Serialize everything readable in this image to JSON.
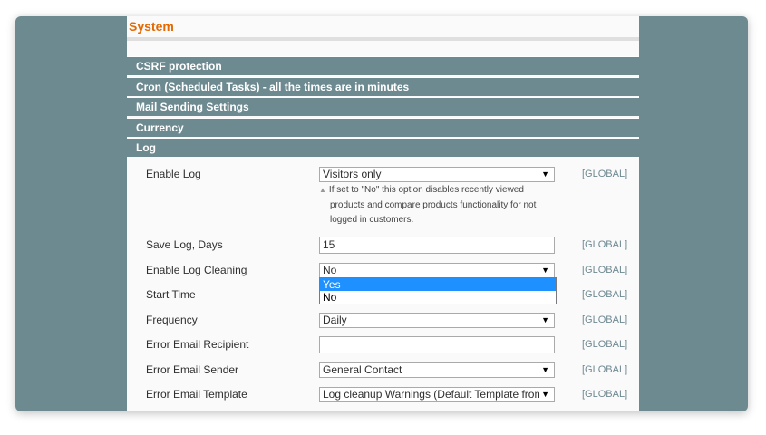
{
  "page": {
    "title": "System"
  },
  "sections": [
    "CSRF protection",
    "Cron (Scheduled Tasks) - all the times are in minutes",
    "Mail Sending Settings",
    "Currency",
    "Log"
  ],
  "log": {
    "enable_log": {
      "label": "Enable Log",
      "value": "Visitors only",
      "scope": "[GLOBAL]",
      "note": "If set to \"No\" this option disables recently viewed products and compare products functionality for not logged in customers."
    },
    "save_log_days": {
      "label": "Save Log, Days",
      "value": "15",
      "scope": "[GLOBAL]"
    },
    "enable_log_cleaning": {
      "label": "Enable Log Cleaning",
      "value": "No",
      "scope": "[GLOBAL]",
      "options": [
        "Yes",
        "No"
      ],
      "highlighted": "Yes"
    },
    "start_time": {
      "label": "Start Time",
      "scope": "[GLOBAL]"
    },
    "frequency": {
      "label": "Frequency",
      "value": "Daily",
      "scope": "[GLOBAL]"
    },
    "error_email_recipient": {
      "label": "Error Email Recipient",
      "value": "",
      "scope": "[GLOBAL]"
    },
    "error_email_sender": {
      "label": "Error Email Sender",
      "value": "General Contact",
      "scope": "[GLOBAL]"
    },
    "error_email_template": {
      "label": "Error Email Template",
      "value": "Log cleanup Warnings (Default Template from",
      "scope": "[GLOBAL]"
    }
  },
  "icons": {
    "select_arrow": "▼",
    "note_marker": "▲"
  },
  "colors": {
    "accent": "#e26903",
    "section_bg": "#6e8a91",
    "highlight": "#1e90ff"
  }
}
